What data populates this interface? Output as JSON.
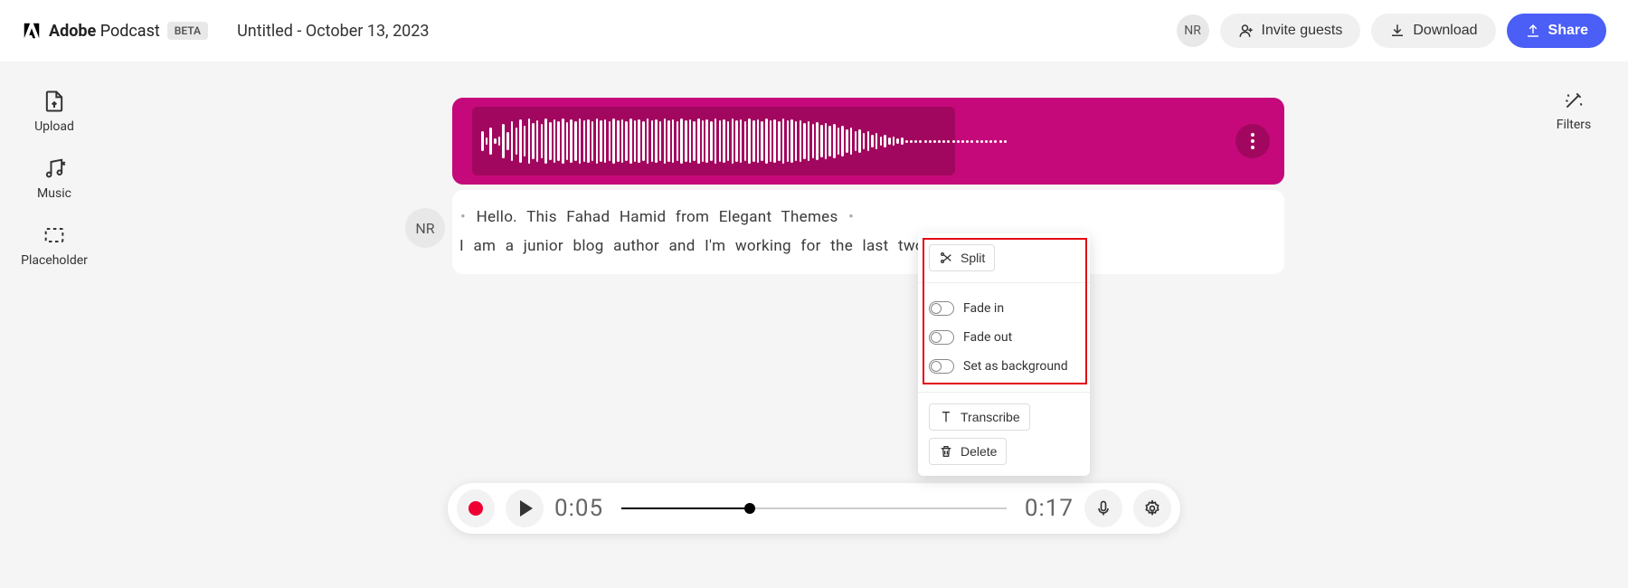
{
  "header": {
    "brand_bold": "Adobe",
    "brand_light": "Podcast",
    "beta": "BETA",
    "doc_title": "Untitled - October 13, 2023",
    "user_initials": "NR",
    "invite": "Invite guests",
    "download": "Download",
    "share": "Share"
  },
  "sidebar_left": {
    "upload": "Upload",
    "music": "Music",
    "placeholder": "Placeholder"
  },
  "sidebar_right": {
    "filters": "Filters"
  },
  "transcript": {
    "avatar": "NR",
    "line1": "Hello.  This Fahad Hamid  from  Elegant Themes",
    "line2": "I  am  a  junior  blog  author and  I'm  working  for  the  last  two  months."
  },
  "context_menu": {
    "split": "Split",
    "fade_in": "Fade in",
    "fade_out": "Fade out",
    "set_bg": "Set as background",
    "transcribe": "Transcribe",
    "delete": "Delete"
  },
  "player": {
    "time_current": "0:05",
    "time_total": "0:17"
  }
}
